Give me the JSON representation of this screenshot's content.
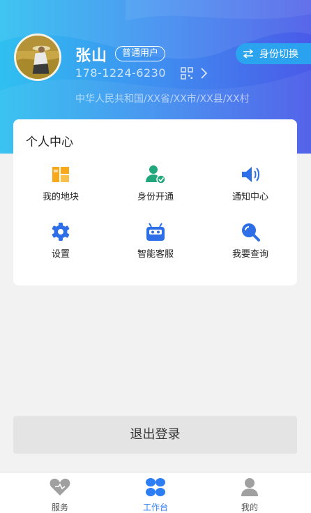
{
  "profile": {
    "name": "张山",
    "badge": "普通用户",
    "phone": "178-1224-6230",
    "address": "中华人民共和国/XX省/XX市/XX县/XX村",
    "switch_label": "身份切换"
  },
  "card": {
    "title": "个人中心",
    "items": [
      {
        "label": "我的地块",
        "icon": "land-icon"
      },
      {
        "label": "身份开通",
        "icon": "user-verify-icon"
      },
      {
        "label": "通知中心",
        "icon": "speaker-icon"
      },
      {
        "label": "设置",
        "icon": "gear-icon"
      },
      {
        "label": "智能客服",
        "icon": "robot-icon"
      },
      {
        "label": "我要查询",
        "icon": "search-icon"
      }
    ]
  },
  "logout_label": "退出登录",
  "tabs": [
    {
      "label": "服务",
      "icon": "heart-icon"
    },
    {
      "label": "工作台",
      "icon": "workbench-icon"
    },
    {
      "label": "我的",
      "icon": "person-icon"
    }
  ],
  "colors": {
    "accent": "#2d7df5",
    "icon_orange": "#f7a81b",
    "icon_teal": "#21a77c",
    "icon_blue": "#2e6ee6"
  }
}
